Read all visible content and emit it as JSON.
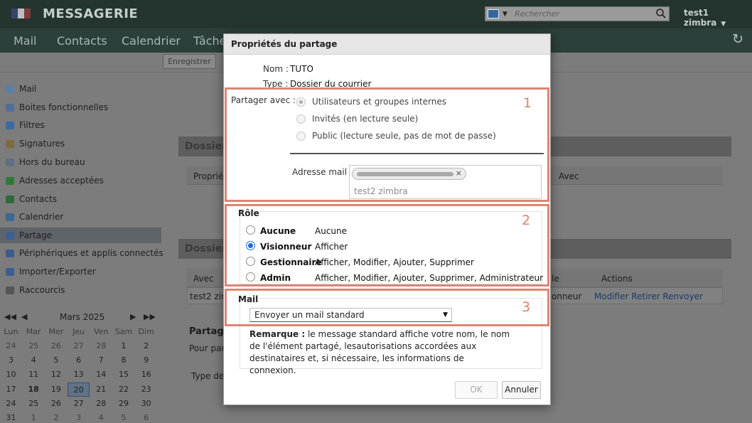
{
  "app": {
    "brand": "MESSAGERIE",
    "search_placeholder": "Rechercher",
    "user": "test1 zimbra",
    "user_caret": "▼",
    "refresh_icon": "↻",
    "nav_tabs": [
      "Mail",
      "Contacts",
      "Calendrier",
      "Tâches"
    ],
    "toolbar_save": "Enregistrer"
  },
  "sidebar": {
    "items": [
      {
        "label": "Mail",
        "icon": "mail-icon",
        "color": "#5b7fa6"
      },
      {
        "label": "Boites fonctionnelles",
        "icon": "shared-mailbox-icon",
        "color": "#4d6f99"
      },
      {
        "label": "Filtres",
        "icon": "filter-icon",
        "color": "#3c6ba3"
      },
      {
        "label": "Signatures",
        "icon": "signature-icon",
        "color": "#7d6a3f"
      },
      {
        "label": "Hors du bureau",
        "icon": "out-of-office-icon",
        "color": "#5e6f86"
      },
      {
        "label": "Adresses acceptées",
        "icon": "shield-icon",
        "color": "#2f7a35"
      },
      {
        "label": "Contacts",
        "icon": "contacts-icon",
        "color": "#2e6a3a"
      },
      {
        "label": "Calendrier",
        "icon": "calendar-icon",
        "color": "#3e6697"
      },
      {
        "label": "Partage",
        "icon": "share-icon",
        "color": "#3e5f92"
      },
      {
        "label": "Périphériques et applis connectés",
        "icon": "devices-icon",
        "color": "#3c5d8c"
      },
      {
        "label": "Importer/Exporter",
        "icon": "import-export-icon",
        "color": "#3a5f90"
      },
      {
        "label": "Raccourcis",
        "icon": "shortcuts-icon",
        "color": "#555555"
      }
    ],
    "selected_index": 8
  },
  "mini_calendar": {
    "prev_year": "◀◀",
    "prev_month": "◀",
    "title": "Mars 2025",
    "next_month": "▶",
    "next_year": "▶▶",
    "day_names": [
      "Lun",
      "Mar",
      "Mer",
      "Jeu",
      "Ven",
      "Sam",
      "Dim"
    ],
    "weeks": [
      [
        "24",
        "25",
        "26",
        "27",
        "28",
        "1",
        "2"
      ],
      [
        "3",
        "4",
        "5",
        "6",
        "7",
        "8",
        "9"
      ],
      [
        "10",
        "11",
        "12",
        "13",
        "14",
        "15",
        "16"
      ],
      [
        "17",
        "18",
        "19",
        "20",
        "21",
        "22",
        "23"
      ],
      [
        "24",
        "25",
        "26",
        "27",
        "28",
        "29",
        "30"
      ],
      [
        "31",
        "1",
        "2",
        "3",
        "4",
        "5",
        "6"
      ]
    ],
    "today": "18",
    "selected": "20"
  },
  "background": {
    "panel1_title": "Dossier",
    "panel1_col": "Propriét",
    "panel1_col2": "Avec",
    "panel2_title": "Dossier",
    "panel2_col_avec": "Avec",
    "panel2_col_role": "le",
    "panel2_col_actions": "Actions",
    "panel2_row_avec": "test2 zim",
    "panel2_row_role": "onneur",
    "panel2_row_actions": "Modifier Retirer Renvoyer",
    "partage_heading": "Partage",
    "partage_text": "Pour part",
    "type_label": "Type de"
  },
  "dialog": {
    "title": "Propriétés du partage",
    "name_label": "Nom :",
    "name_value": "TUTO",
    "type_label": "Type :",
    "type_value": "Dossier du courrier",
    "share_with_label": "Partager avec :",
    "share_options": [
      {
        "label": "Utilisateurs et groupes internes",
        "selected": true
      },
      {
        "label": "Invités (en lecture seule)",
        "selected": false
      },
      {
        "label": "Public (lecture seule, pas de mot de passe)",
        "selected": false
      }
    ],
    "mail_address_label": "Adresse mail :",
    "chip_remove": "×",
    "suggestion": "test2 zimbra",
    "role_title": "Rôle",
    "roles": [
      {
        "name": "Aucune",
        "desc": "Aucune",
        "selected": false
      },
      {
        "name": "Visionneur",
        "desc": "Afficher",
        "selected": true
      },
      {
        "name": "Gestionnaire",
        "desc": "Afficher, Modifier, Ajouter, Supprimer",
        "selected": false
      },
      {
        "name": "Admin",
        "desc": "Afficher, Modifier, Ajouter, Supprimer, Administrateur",
        "selected": false
      }
    ],
    "mail_title": "Mail",
    "mail_select_value": "Envoyer un mail standard",
    "remark_bold": "Remarque :",
    "remark_text": " le message standard affiche votre nom, le nom de l'élément partagé, lesautorisations accordées aux destinataires et, si nécessaire, les informations de connexion.",
    "ok_label": "OK",
    "cancel_label": "Annuler"
  },
  "annotations": [
    "1",
    "2",
    "3"
  ],
  "colors": {
    "annotation": "#dd8576",
    "radio_active": "#1a6fd8",
    "link": "#1b3a66"
  }
}
